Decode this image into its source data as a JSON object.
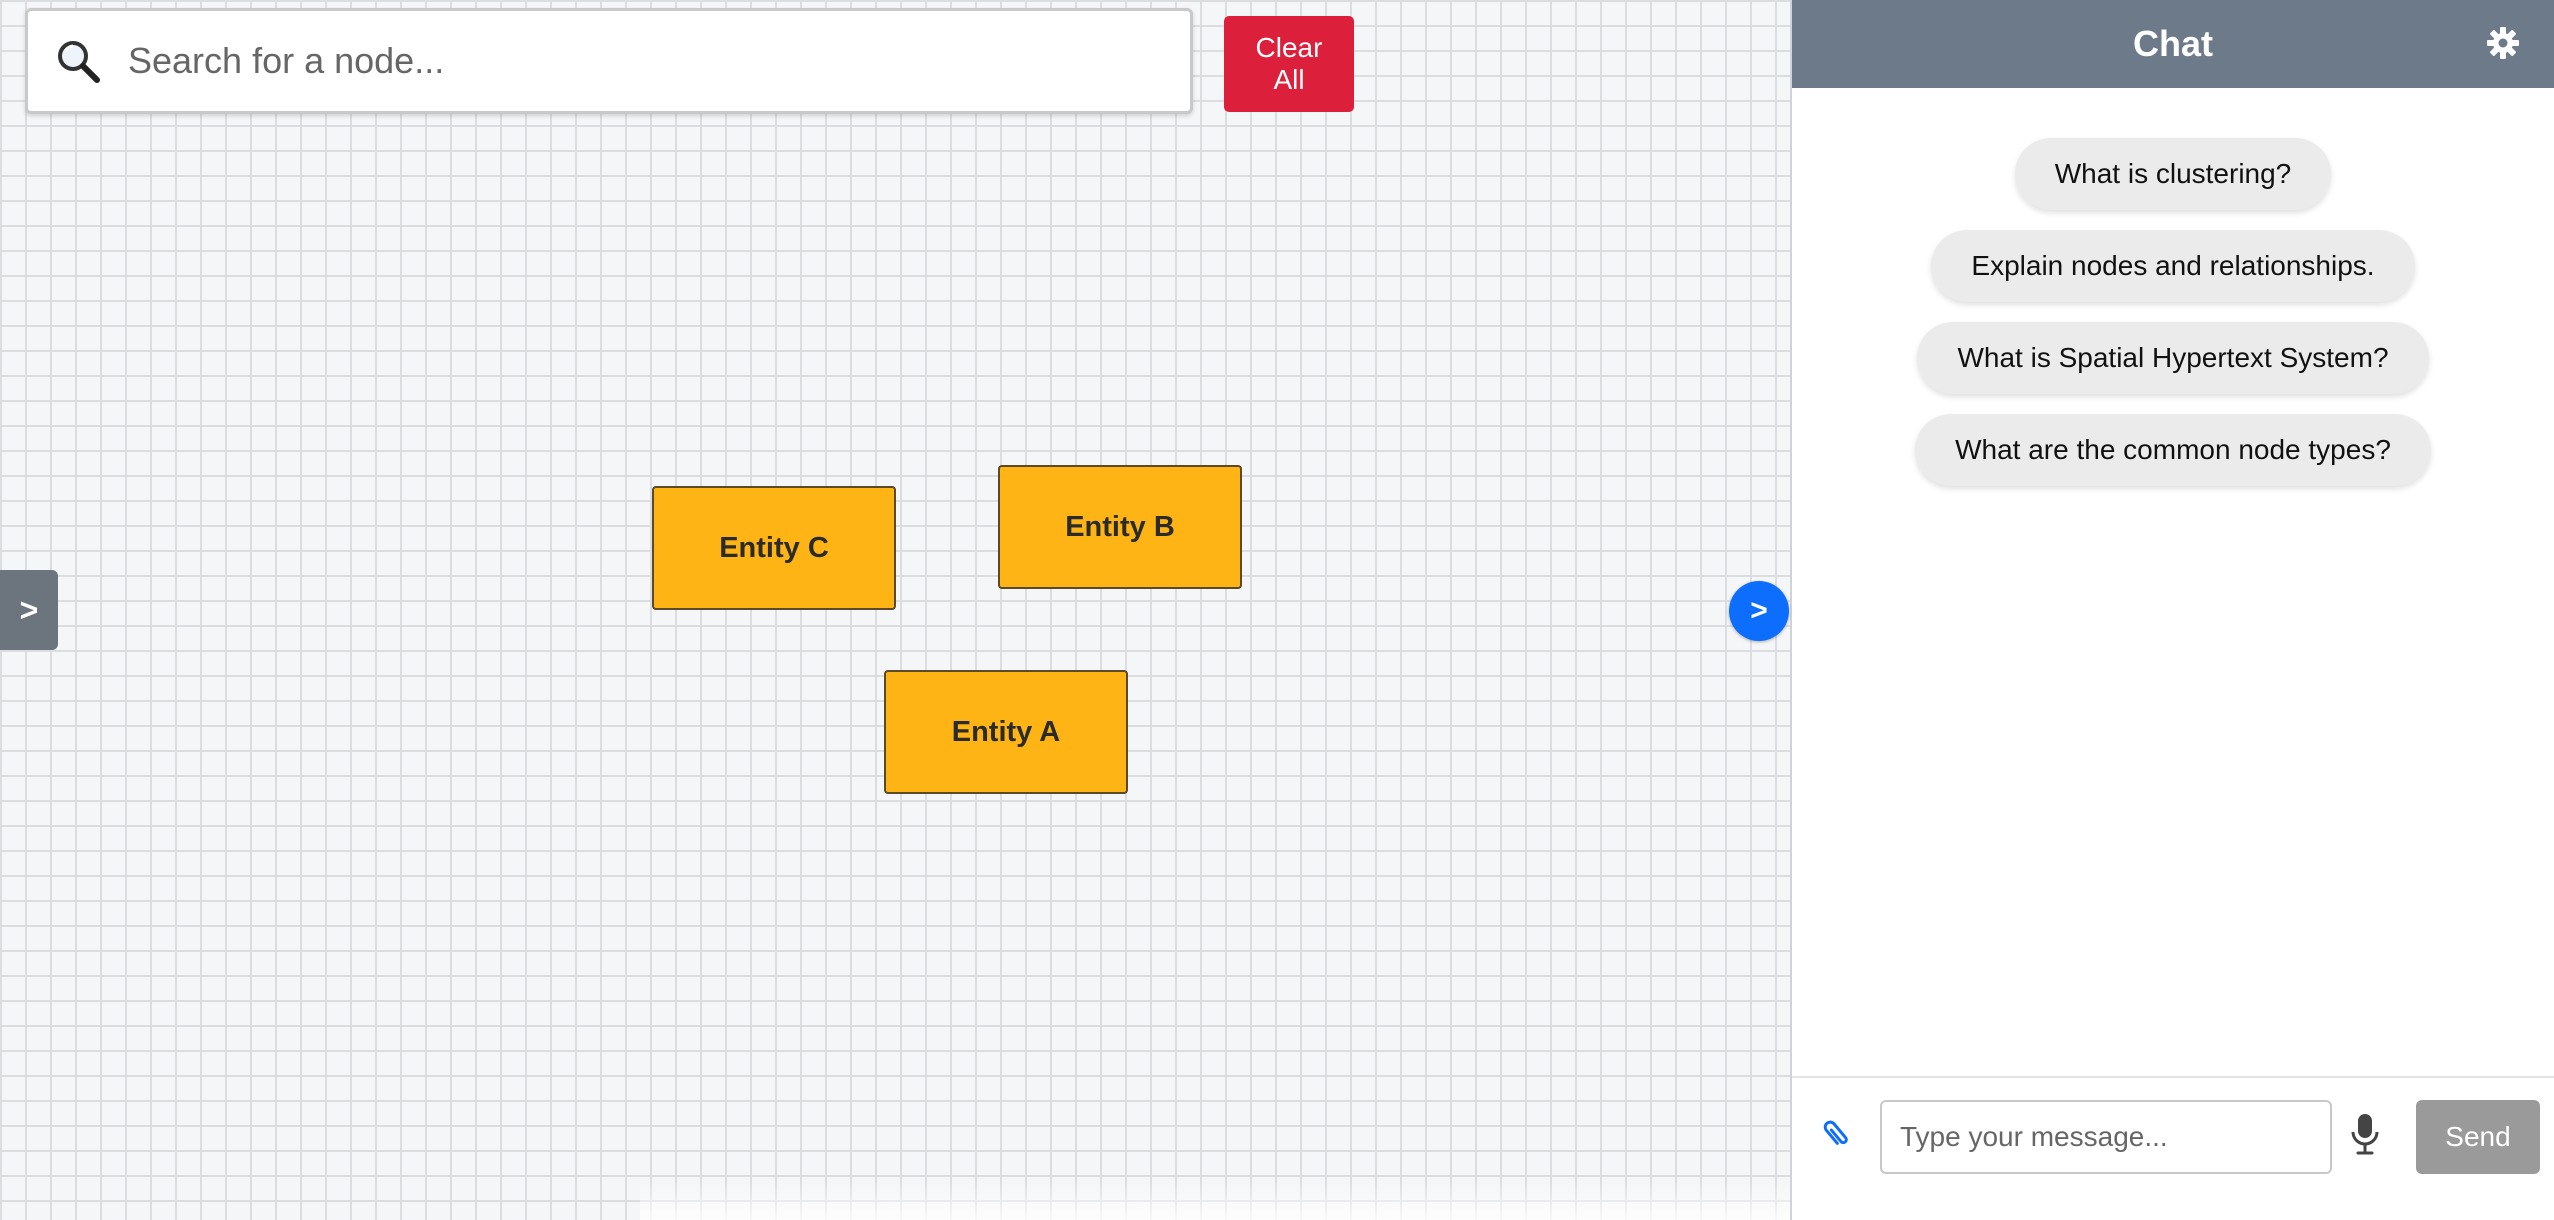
{
  "canvas": {
    "search": {
      "placeholder": "Search for a node...",
      "value": "",
      "icon": "magnifier-icon"
    },
    "clear_button": {
      "label": "Clear All",
      "color": "#dc1f3a"
    },
    "nodes": [
      {
        "id": "entity-c",
        "label": "Entity C"
      },
      {
        "id": "entity-b",
        "label": "Entity B"
      },
      {
        "id": "entity-a",
        "label": "Entity A"
      }
    ],
    "node_color": "#fdb414",
    "left_toggle_label": ">",
    "right_toggle_label": ">",
    "accent_color": "#0d6efd"
  },
  "chat": {
    "title": "Chat",
    "header_color": "#6c7a89",
    "settings_icon": "gear-icon",
    "suggestions": [
      "What is clustering?",
      "Explain nodes and relationships.",
      "What is Spatial Hypertext System?",
      "What are the common node types?"
    ],
    "input": {
      "placeholder": "Type your message...",
      "value": ""
    },
    "attach_icon": "paperclip-icon",
    "mic_icon": "microphone-icon",
    "send_label": "Send"
  }
}
